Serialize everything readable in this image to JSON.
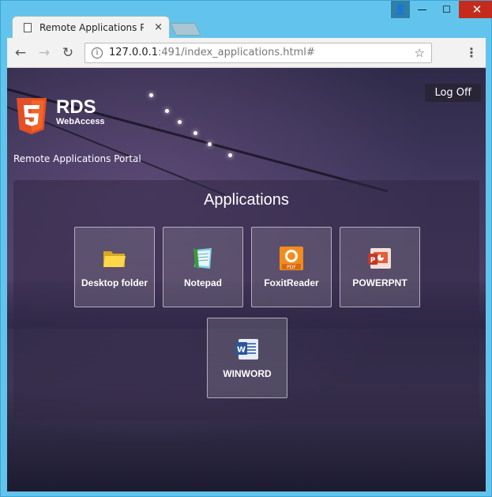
{
  "browser": {
    "tab_title": "Remote Applications Por",
    "tab_close": "×",
    "url_host": "127.0.0.1",
    "url_path": ":491/index_applications.html#",
    "back": "←",
    "forward": "→",
    "reload": "↻",
    "info": "i",
    "star": "☆",
    "menu": "⋮"
  },
  "window_controls": {
    "user": "👤",
    "minimize": "—",
    "maximize": "☐",
    "close": "✕"
  },
  "page": {
    "logoff_label": "Log Off",
    "brand_name": "RDS",
    "brand_sub": "WebAccess",
    "portal_label": "Remote Applications Portal",
    "panel_title": "Applications",
    "apps": [
      {
        "name": "Desktop folder",
        "icon": "folder-icon"
      },
      {
        "name": "Notepad",
        "icon": "notepad-icon"
      },
      {
        "name": "FoxitReader",
        "icon": "foxit-pdf-icon"
      },
      {
        "name": "POWERPNT",
        "icon": "powerpoint-icon"
      },
      {
        "name": "WINWORD",
        "icon": "word-icon"
      }
    ]
  },
  "colors": {
    "titlebar": "#62c4ec",
    "close_button": "#c42b1c",
    "html5_orange": "#e34f26"
  }
}
